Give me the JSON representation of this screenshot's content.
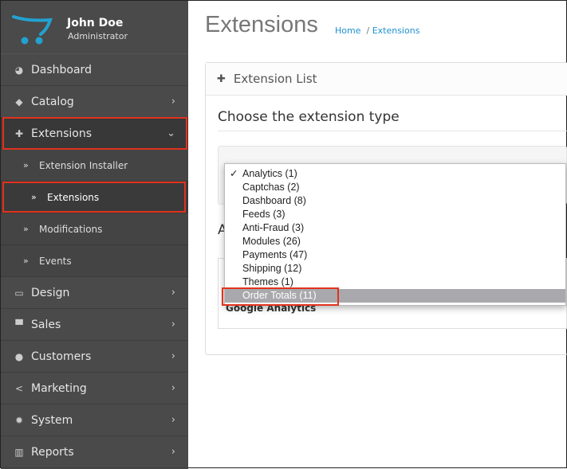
{
  "user": {
    "name": "John Doe",
    "role": "Administrator"
  },
  "sidebar": {
    "items": [
      {
        "label": "Dashboard",
        "icon": "dashboard-icon"
      },
      {
        "label": "Catalog",
        "icon": "tag-icon"
      },
      {
        "label": "Extensions",
        "icon": "puzzle-icon",
        "children": [
          {
            "label": "Extension Installer"
          },
          {
            "label": "Extensions"
          },
          {
            "label": "Modifications"
          },
          {
            "label": "Events"
          }
        ]
      },
      {
        "label": "Design",
        "icon": "desktop-icon"
      },
      {
        "label": "Sales",
        "icon": "cart-icon"
      },
      {
        "label": "Customers",
        "icon": "user-icon"
      },
      {
        "label": "Marketing",
        "icon": "share-icon"
      },
      {
        "label": "System",
        "icon": "gear-icon"
      },
      {
        "label": "Reports",
        "icon": "bar-chart-icon"
      }
    ]
  },
  "header": {
    "title": "Extensions",
    "breadcrumb": [
      "Home",
      "Extensions"
    ]
  },
  "panel": {
    "title": "Extension List",
    "choose_label": "Choose the extension type",
    "section_heading_partial": "A",
    "table_row": "Google Analytics"
  },
  "dropdown": {
    "selected": "Analytics (1)",
    "highlighted": "Order Totals (11)",
    "options": [
      "Analytics (1)",
      "Captchas (2)",
      "Dashboard (8)",
      "Feeds (3)",
      "Anti-Fraud (3)",
      "Modules (26)",
      "Payments (47)",
      "Shipping (12)",
      "Themes (1)",
      "Order Totals (11)"
    ]
  },
  "colors": {
    "accent": "#1e91cf",
    "highlight_box": "#e2321d",
    "logo": "#23a1d1"
  }
}
